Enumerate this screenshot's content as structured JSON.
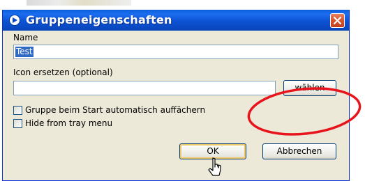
{
  "window": {
    "title": "Gruppeneigenschaften",
    "title_icon": "circle-arrow-icon",
    "close_icon": "close-icon",
    "colors": {
      "titlebar": "#0a53d0",
      "body": "#ece9d8",
      "close_button": "#d9542c",
      "selection": "#316ac5",
      "annotation_circle": "#e8141c"
    }
  },
  "form": {
    "name_label": "Name",
    "name_value": "Test",
    "icon_label": "Icon ersetzen (optional)",
    "icon_value": "",
    "choose_button": "wählen",
    "expand_checkbox_label": "Gruppe beim Start automatisch auffächern",
    "expand_checked": false,
    "hide_checkbox_label": "Hide from tray menu",
    "hide_checked": false
  },
  "buttons": {
    "ok": "OK",
    "cancel": "Abbrechen"
  },
  "annotation": {
    "shape": "red-ellipse",
    "target": "choose_button"
  }
}
